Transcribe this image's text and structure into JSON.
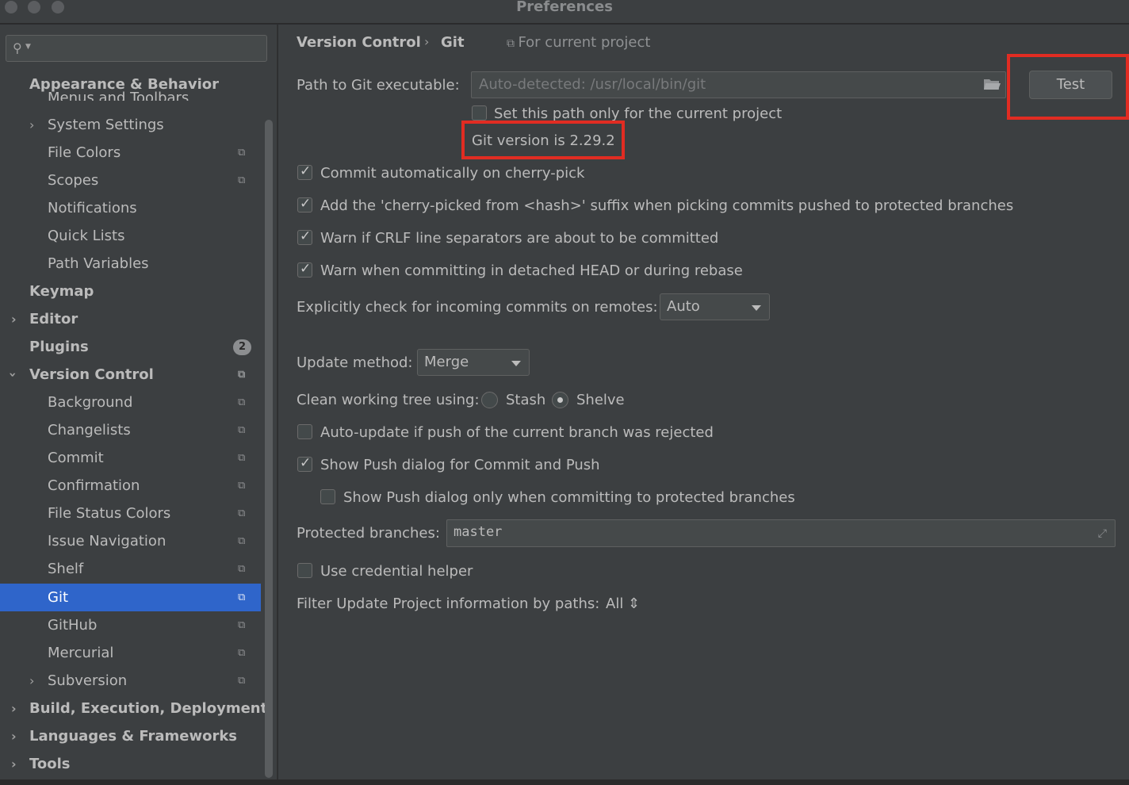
{
  "window": {
    "title": "Preferences"
  },
  "search": {
    "placeholder": ""
  },
  "sidebar": {
    "clipped_item": "Menus and Toolbars",
    "items": [
      {
        "label": "Appearance & Behavior",
        "bold": true
      },
      {
        "label": "System Settings"
      },
      {
        "label": "File Colors"
      },
      {
        "label": "Scopes"
      },
      {
        "label": "Notifications"
      },
      {
        "label": "Quick Lists"
      },
      {
        "label": "Path Variables"
      },
      {
        "label": "Keymap",
        "bold": true
      },
      {
        "label": "Editor",
        "bold": true
      },
      {
        "label": "Plugins",
        "bold": true,
        "badge": "2"
      },
      {
        "label": "Version Control",
        "bold": true
      },
      {
        "label": "Background"
      },
      {
        "label": "Changelists"
      },
      {
        "label": "Commit"
      },
      {
        "label": "Confirmation"
      },
      {
        "label": "File Status Colors"
      },
      {
        "label": "Issue Navigation"
      },
      {
        "label": "Shelf"
      },
      {
        "label": "Git",
        "selected": true
      },
      {
        "label": "GitHub"
      },
      {
        "label": "Mercurial"
      },
      {
        "label": "Subversion"
      },
      {
        "label": "Build, Execution, Deployment",
        "bold": true
      },
      {
        "label": "Languages & Frameworks",
        "bold": true
      },
      {
        "label": "Tools",
        "bold": true
      }
    ]
  },
  "breadcrumb": {
    "parent": "Version Control",
    "current": "Git",
    "sep": "›",
    "scope": "For current project"
  },
  "git": {
    "path_label": "Path to Git executable:",
    "path_placeholder": "Auto-detected: /usr/local/bin/git",
    "test_label": "Test",
    "set_path_only": "Set this path only for the current project",
    "version_text": "Git version is 2.29.2",
    "commit_cherry_pick": "Commit automatically on cherry-pick",
    "cherry_picked_suffix": "Add the 'cherry-picked from <hash>' suffix when picking commits pushed to protected branches",
    "warn_crlf": "Warn if CRLF line separators are about to be committed",
    "warn_detached": "Warn when committing in detached HEAD or during rebase",
    "incoming_label": "Explicitly check for incoming commits on remotes:",
    "incoming_value": "Auto",
    "update_method_label": "Update method:",
    "update_method_value": "Merge",
    "clean_tree_label": "Clean working tree using:",
    "stash_label": "Stash",
    "shelve_label": "Shelve",
    "auto_update": "Auto-update if push of the current branch was rejected",
    "show_push": "Show Push dialog for Commit and Push",
    "show_push_protected": "Show Push dialog only when committing to protected branches",
    "protected_label": "Protected branches:",
    "protected_value": "master",
    "credential_helper": "Use credential helper",
    "filter_label": "Filter Update Project information by paths:",
    "filter_value": "All ⇕"
  },
  "colors": {
    "selection": "#2f65ca",
    "highlight": "#e12c22"
  }
}
